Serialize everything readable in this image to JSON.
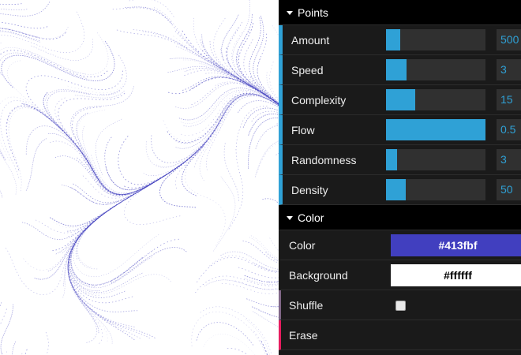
{
  "canvas": {
    "stroke_color": "#413fbf",
    "background_color": "#ffffff"
  },
  "points_folder": {
    "title": "Points",
    "controls": [
      {
        "label": "Amount",
        "value": "500",
        "fill": 0.14
      },
      {
        "label": "Speed",
        "value": "3",
        "fill": 0.21
      },
      {
        "label": "Complexity",
        "value": "15",
        "fill": 0.29
      },
      {
        "label": "Flow",
        "value": "0.5",
        "fill": 1.0
      },
      {
        "label": "Randomness",
        "value": "3",
        "fill": 0.11
      },
      {
        "label": "Density",
        "value": "50",
        "fill": 0.2
      }
    ]
  },
  "color_folder": {
    "title": "Color",
    "color": {
      "label": "Color",
      "value": "#413fbf",
      "swatch": "#413fbf",
      "text_color": "#ffffff"
    },
    "background": {
      "label": "Background",
      "value": "#ffffff",
      "swatch": "#ffffff",
      "text_color": "#000000"
    }
  },
  "shuffle": {
    "label": "Shuffle",
    "checked": false
  },
  "erase": {
    "label": "Erase"
  },
  "accent_colors": {
    "number": "#2fa1d6",
    "boolean": "#806787",
    "function": "#e61d5f"
  }
}
